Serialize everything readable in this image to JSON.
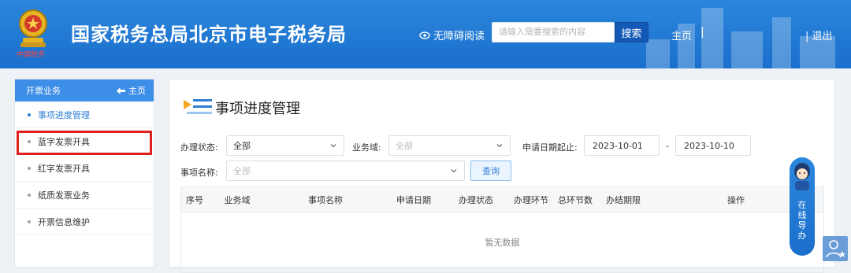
{
  "header": {
    "emblem_text": "中国税务",
    "title": "国家税务总局北京市电子税务局",
    "a11y_label": "无障碍阅读",
    "search_placeholder": "请输入需要搜索的内容",
    "search_button": "搜索",
    "home_link": "主页",
    "separator": "|",
    "logout_link": "| 退出"
  },
  "sidebar": {
    "title": "开票业务",
    "home_label": "主页",
    "items": [
      {
        "label": "事项进度管理"
      },
      {
        "label": "蓝字发票开具"
      },
      {
        "label": "红字发票开具"
      },
      {
        "label": "纸质发票业务"
      },
      {
        "label": "开票信息维护"
      }
    ]
  },
  "main": {
    "title": "事项进度管理",
    "filters": {
      "status_label": "办理状态:",
      "status_value": "全部",
      "domain_label": "业务域:",
      "domain_value": "全部",
      "date_label": "申请日期起止:",
      "date_start": "2023-10-01",
      "date_sep": "-",
      "date_end": "2023-10-10",
      "name_label": "事项名称:",
      "name_value": "全部",
      "query_button": "查询"
    },
    "table": {
      "columns": [
        "序号",
        "业务域",
        "事项名称",
        "申请日期",
        "办理状态",
        "办理环节",
        "总环节数",
        "办结期限",
        "操作"
      ],
      "empty_text": "暂无数据"
    }
  },
  "guide": {
    "chars": [
      "在",
      "线",
      "导",
      "办"
    ]
  },
  "colors": {
    "header_blue": "#1f77d2",
    "accent": "#2f7fd6",
    "highlight": "#e0201f"
  }
}
